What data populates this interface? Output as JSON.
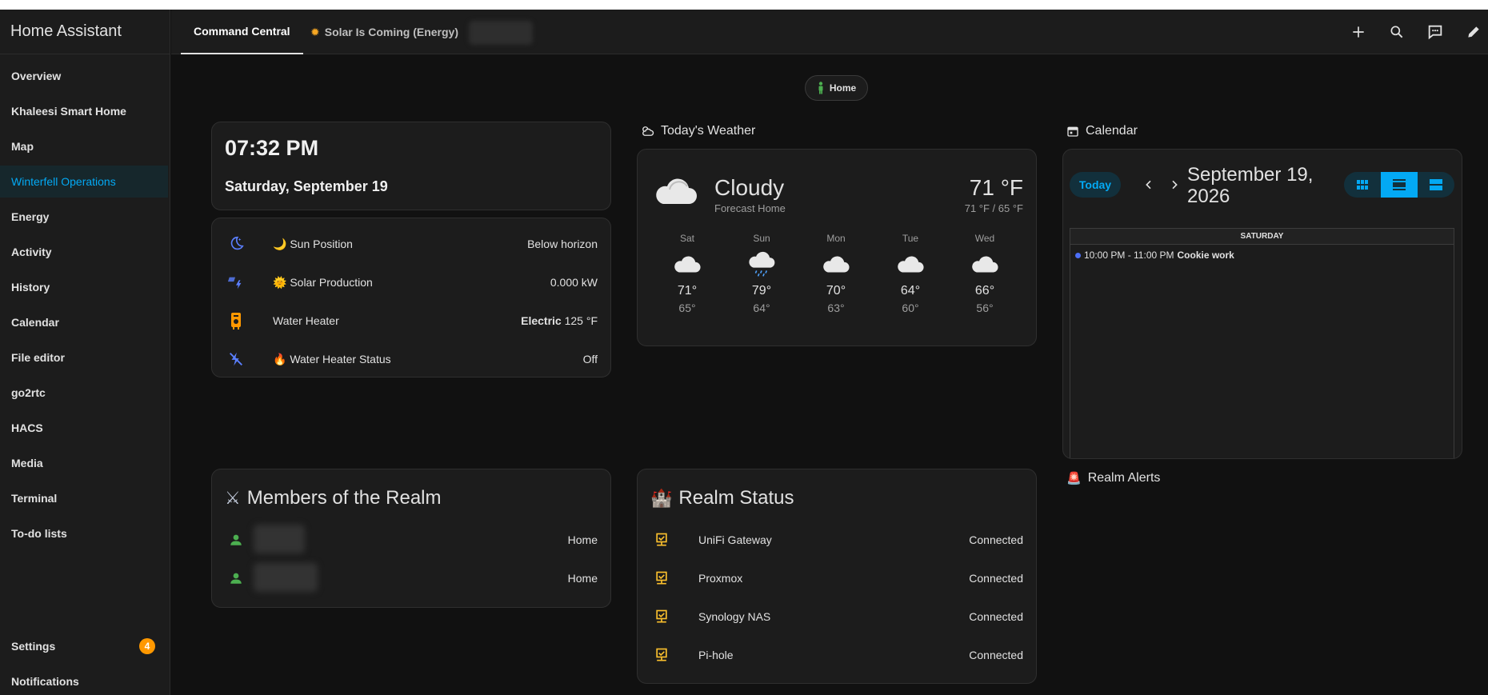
{
  "app": {
    "title": "Home Assistant"
  },
  "sidebar": {
    "items": [
      {
        "label": "Overview"
      },
      {
        "label": "Khaleesi Smart Home"
      },
      {
        "label": "Map"
      },
      {
        "label": "Winterfell Operations"
      },
      {
        "label": "Energy"
      },
      {
        "label": "Activity"
      },
      {
        "label": "History"
      },
      {
        "label": "Calendar"
      },
      {
        "label": "File editor"
      },
      {
        "label": "go2rtc"
      },
      {
        "label": "HACS"
      },
      {
        "label": "Media"
      },
      {
        "label": "Terminal"
      },
      {
        "label": "To-do lists"
      }
    ],
    "settings": {
      "label": "Settings",
      "badge": "4"
    },
    "notifications": {
      "label": "Notifications"
    }
  },
  "header": {
    "tabs": [
      {
        "label": "Command Central"
      },
      {
        "label": "Solar Is Coming (Energy)"
      }
    ],
    "actions": [
      "plus-icon",
      "search-icon",
      "assist-icon",
      "pencil-icon"
    ]
  },
  "home_chip": {
    "label": "Home"
  },
  "clock": {
    "time": "07:32 PM",
    "date": "Saturday, September 19"
  },
  "status_rows": [
    {
      "name": "🌙 Sun Position",
      "value": "Below horizon",
      "icon": "weather-night-icon"
    },
    {
      "name": "🌞 Solar Production",
      "value": "0.000 kW",
      "icon": "solar-power-icon"
    },
    {
      "name": "Water Heater",
      "value_bold": "Electric",
      "value": "125 °F",
      "icon": "water-boiler-icon"
    },
    {
      "name": "🔥 Water Heater Status",
      "value": "Off",
      "icon": "flash-off-icon"
    }
  ],
  "weather": {
    "title": "Today's Weather",
    "condition": "Cloudy",
    "subtitle": "Forecast Home",
    "temperature": "71 °F",
    "high_low": "71 °F / 65 °F",
    "forecast": [
      {
        "day": "Sat",
        "high": "71°",
        "low": "65°",
        "icon": "cloudy-icon"
      },
      {
        "day": "Sun",
        "high": "79°",
        "low": "64°",
        "icon": "rainy-icon"
      },
      {
        "day": "Mon",
        "high": "70°",
        "low": "63°",
        "icon": "cloudy-icon"
      },
      {
        "day": "Tue",
        "high": "64°",
        "low": "60°",
        "icon": "cloudy-icon"
      },
      {
        "day": "Wed",
        "high": "66°",
        "low": "56°",
        "icon": "cloudy-icon"
      }
    ]
  },
  "calendar": {
    "title": "Calendar",
    "today_label": "Today",
    "date_label": "September 19, 2026",
    "day_header": "SATURDAY",
    "event": {
      "time": "10:00 PM - 11:00 PM",
      "title": "Cookie work"
    }
  },
  "members": {
    "title": "Members of the Realm",
    "rows": [
      {
        "value": "Home"
      },
      {
        "value": "Home"
      }
    ]
  },
  "realm_status": {
    "title": "Realm Status",
    "rows": [
      {
        "name": "UniFi Gateway",
        "value": "Connected"
      },
      {
        "name": "Proxmox",
        "value": "Connected"
      },
      {
        "name": "Synology NAS",
        "value": "Connected"
      },
      {
        "name": "Pi-hole",
        "value": "Connected"
      }
    ]
  },
  "realm_alerts": {
    "title": "Realm Alerts"
  },
  "colors": {
    "accent": "#03a9f4",
    "badge": "#ff9800",
    "ok_green": "#4caf50",
    "amber": "#fbc02d"
  }
}
